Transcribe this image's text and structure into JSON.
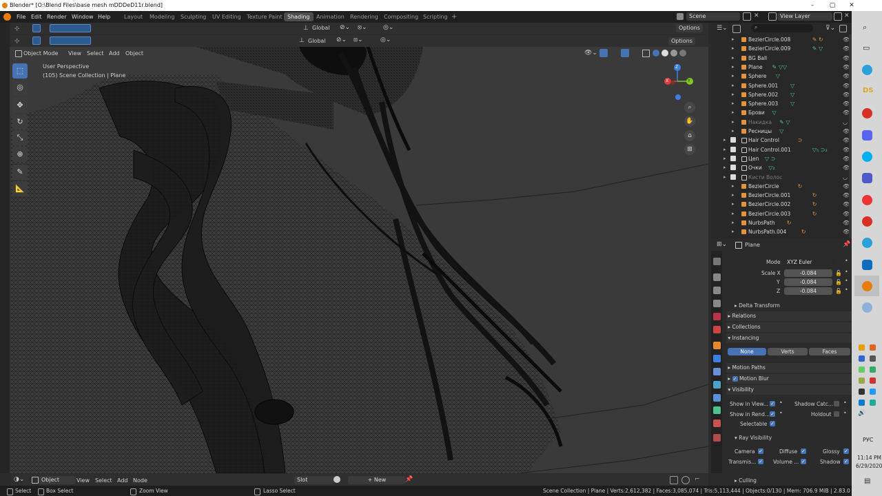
{
  "window": {
    "title": "Blender* [O:\\Blend Files\\base mesh mDDDeD11r.blend]",
    "minimize": "–",
    "maximize": "▢",
    "close": "✕"
  },
  "menu": {
    "items": [
      "File",
      "Edit",
      "Render",
      "Window",
      "Help"
    ]
  },
  "workspaces": {
    "tabs": [
      "Layout",
      "Modeling",
      "Sculpting",
      "UV Editing",
      "Texture Paint",
      "Shading",
      "Animation",
      "Rendering",
      "Compositing",
      "Scripting"
    ],
    "active": "Shading",
    "add": "+"
  },
  "scene": {
    "name": "Scene",
    "view_layer": "View Layer"
  },
  "toolbar": {
    "orientation_top": "Global",
    "orientation": "Global",
    "options": "Options"
  },
  "viewport": {
    "mode": "Object Mode",
    "menus": [
      "View",
      "Select",
      "Add",
      "Object"
    ],
    "overlay_line1": "User Perspective",
    "overlay_line2": "(105) Scene Collection | Plane",
    "gizmo": {
      "z": "Z",
      "y": "Y",
      "x": "X"
    },
    "colors": {
      "x_axis": "#e33c3c",
      "y_axis": "#82c91e",
      "z_axis": "#3b7fe3",
      "selected_tool": "#4772b3"
    }
  },
  "outliner": {
    "search_placeholder": "",
    "rows": [
      {
        "name": "BezierCircle.008",
        "mods": "✎ ↻"
      },
      {
        "name": "BezierCircle.009",
        "mods": "✎ ▽"
      },
      {
        "name": "BG Ball",
        "mods": ""
      },
      {
        "name": "Plane",
        "mods": "✎ ▽▽"
      },
      {
        "name": "Sphere",
        "mods": "▽"
      },
      {
        "name": "Sphere.001",
        "mods": "▽"
      },
      {
        "name": "Sphere.002",
        "mods": "▽"
      },
      {
        "name": "Sphere.003",
        "mods": "▽"
      },
      {
        "name": "Брови",
        "mods": "▽"
      },
      {
        "name": "Накидка",
        "mods": "✎ ▽"
      },
      {
        "name": "Ресницы",
        "mods": "▽"
      },
      {
        "name": "Hair Control",
        "mods": "⊃"
      },
      {
        "name": "Hair Control.001",
        "mods": "▽₅ ⊃₃"
      },
      {
        "name": "Цеп",
        "mods": "▽ ⊃"
      },
      {
        "name": "Очки",
        "mods": "▽₂"
      },
      {
        "name": "Кисти Волос",
        "mods": ""
      },
      {
        "name": "BezierCircle",
        "mods": "↻"
      },
      {
        "name": "BezierCircle.001",
        "mods": "↻"
      },
      {
        "name": "BezierCircle.002",
        "mods": "↻"
      },
      {
        "name": "BezierCircle.003",
        "mods": "↻"
      },
      {
        "name": "NurbsPath",
        "mods": "↻"
      },
      {
        "name": "NurbsPath.004",
        "mods": "↻"
      }
    ]
  },
  "properties": {
    "object_name": "Plane",
    "mode_label": "Mode",
    "mode_value": "XYZ Euler",
    "scale_x_label": "Scale X",
    "scale_y_label": "Y",
    "scale_z_label": "Z",
    "scale_x": "-0.084",
    "scale_y": "-0.084",
    "scale_z": "-0.084",
    "delta_transform": "Delta Transform",
    "relations": "Relations",
    "collections": "Collections",
    "instancing": "Instancing",
    "instancing_options": [
      "None",
      "Verts",
      "Faces"
    ],
    "motion_paths": "Motion Paths",
    "motion_blur": "Motion Blur",
    "visibility": "Visibility",
    "show_in_viewports": "Show in View...",
    "shadow_catcher": "Shadow Catc...",
    "show_in_renders": "Show in Rend...",
    "holdout": "Holdout",
    "selectable": "Selectable",
    "ray_visibility": "Ray Visibility",
    "camera": "Camera",
    "diffuse": "Diffuse",
    "glossy": "Glossy",
    "transmission": "Transmis...",
    "volume": "Volume ...",
    "shadow": "Shadow",
    "culling": "Culling"
  },
  "shader_editor": {
    "type": "Object",
    "menus": [
      "View",
      "Select",
      "Add",
      "Node"
    ],
    "slot": "Slot",
    "new": "New"
  },
  "status": {
    "select": "Select",
    "box_select": "Box Select",
    "zoom_view": "Zoom View",
    "lasso_select": "Lasso Select",
    "stats": "Scene Collection | Plane | Verts:2,612,382 | Faces:3,085,074 | Tris:5,113,444 | Objects:0/130 | Mem: 706.9 MiB | 2.83.0"
  },
  "taskbar": {
    "time": "11:14 PM",
    "date": "6/29/2020",
    "lang": "РУС",
    "ds_label": "DS"
  }
}
